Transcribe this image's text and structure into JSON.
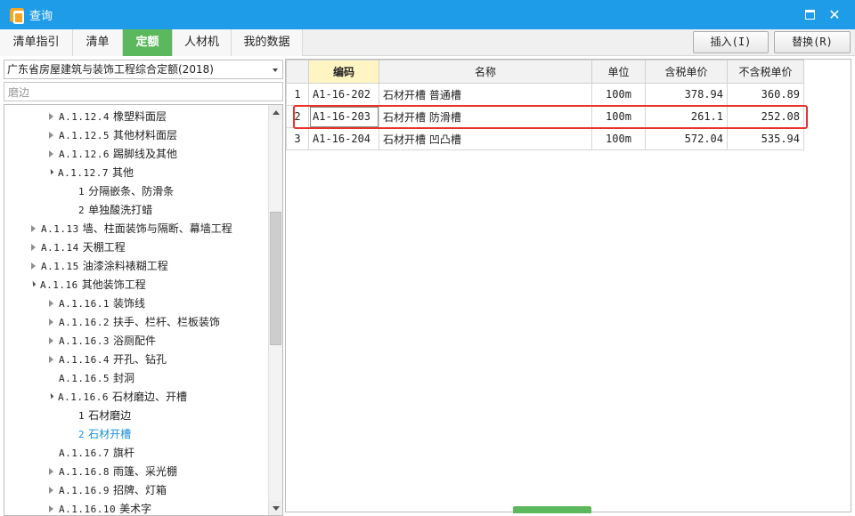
{
  "window": {
    "title": "查询"
  },
  "tabs": [
    "清单指引",
    "清单",
    "定额",
    "人材机",
    "我的数据"
  ],
  "active_tab": "定额",
  "buttons": {
    "insert": "插入(I)",
    "replace": "替换(R)"
  },
  "left": {
    "quota_library": "广东省房屋建筑与装饰工程综合定额(2018)",
    "search_value": "磨边",
    "tree": [
      {
        "code": "A.1.12.4",
        "label": "橡塑料面层",
        "state": "collapsed",
        "indent": 2
      },
      {
        "code": "A.1.12.5",
        "label": "其他材料面层",
        "state": "collapsed",
        "indent": 2
      },
      {
        "code": "A.1.12.6",
        "label": "踢脚线及其他",
        "state": "collapsed",
        "indent": 2
      },
      {
        "code": "A.1.12.7",
        "label": "其他",
        "state": "expanded",
        "indent": 2
      },
      {
        "code": "1",
        "label": "分隔嵌条、防滑条",
        "state": "none",
        "indent": 3
      },
      {
        "code": "2",
        "label": "单独酸洗打蜡",
        "state": "none",
        "indent": 3
      },
      {
        "code": "A.1.13",
        "label": "墙、柱面装饰与隔断、幕墙工程",
        "state": "collapsed",
        "indent": 1
      },
      {
        "code": "A.1.14",
        "label": "天棚工程",
        "state": "collapsed",
        "indent": 1
      },
      {
        "code": "A.1.15",
        "label": "油漆涂料裱糊工程",
        "state": "collapsed",
        "indent": 1
      },
      {
        "code": "A.1.16",
        "label": "其他装饰工程",
        "state": "expanded",
        "indent": 1
      },
      {
        "code": "A.1.16.1",
        "label": "装饰线",
        "state": "collapsed",
        "indent": 2
      },
      {
        "code": "A.1.16.2",
        "label": "扶手、栏杆、栏板装饰",
        "state": "collapsed",
        "indent": 2
      },
      {
        "code": "A.1.16.3",
        "label": "浴厕配件",
        "state": "collapsed",
        "indent": 2
      },
      {
        "code": "A.1.16.4",
        "label": "开孔、钻孔",
        "state": "collapsed",
        "indent": 2
      },
      {
        "code": "A.1.16.5",
        "label": "封洞",
        "state": "none",
        "indent": 2
      },
      {
        "code": "A.1.16.6",
        "label": "石材磨边、开槽",
        "state": "expanded",
        "indent": 2
      },
      {
        "code": "1",
        "label": "石材磨边",
        "state": "none",
        "indent": 3
      },
      {
        "code": "2",
        "label": "石材开槽",
        "state": "none",
        "indent": 3,
        "selected": true
      },
      {
        "code": "A.1.16.7",
        "label": "旗杆",
        "state": "none",
        "indent": 2
      },
      {
        "code": "A.1.16.8",
        "label": "雨篷、采光棚",
        "state": "collapsed",
        "indent": 2
      },
      {
        "code": "A.1.16.9",
        "label": "招牌、灯箱",
        "state": "collapsed",
        "indent": 2
      },
      {
        "code": "A.1.16.10",
        "label": "美术字",
        "state": "collapsed",
        "indent": 2
      }
    ]
  },
  "grid": {
    "columns": [
      "",
      "编码",
      "名称",
      "单位",
      "含税单价",
      "不含税单价"
    ],
    "rows": [
      {
        "no": "1",
        "code": "A1-16-202",
        "name": "石材开槽 普通槽",
        "unit": "100m",
        "tax_price": "378.94",
        "notax_price": "360.89"
      },
      {
        "no": "2",
        "code": "A1-16-203",
        "name": "石材开槽 防滑槽",
        "unit": "100m",
        "tax_price": "261.1",
        "notax_price": "252.08"
      },
      {
        "no": "3",
        "code": "A1-16-204",
        "name": "石材开槽 凹凸槽",
        "unit": "100m",
        "tax_price": "572.04",
        "notax_price": "535.94"
      }
    ],
    "current_row": 1
  },
  "colors": {
    "titlebar": "#1f9ce8",
    "active_tab": "#5cb85c",
    "highlight": "#e8312b",
    "selected_tree": "#1a8fd8"
  }
}
